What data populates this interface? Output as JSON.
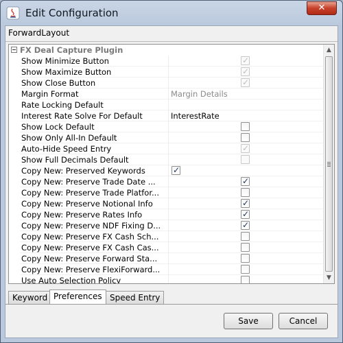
{
  "window": {
    "title": "Edit Configuration",
    "close_glyph": "✕",
    "app_icon": "java-icon"
  },
  "layout_name": "ForwardLayout",
  "group": {
    "title": "FX Deal Capture Plugin",
    "expanded": true
  },
  "rows": [
    {
      "name": "Show Minimize Button",
      "type": "checkbox",
      "checked": true,
      "enabled": false,
      "value": ""
    },
    {
      "name": "Show Maximize Button",
      "type": "checkbox",
      "checked": true,
      "enabled": false,
      "value": ""
    },
    {
      "name": "Show Close Button",
      "type": "checkbox",
      "checked": true,
      "enabled": false,
      "value": ""
    },
    {
      "name": "Margin Format",
      "type": "text",
      "value": "Margin Details",
      "enabled": false
    },
    {
      "name": "Rate Locking Default",
      "type": "text",
      "value": "",
      "enabled": true
    },
    {
      "name": "Interest Rate Solve For Default",
      "type": "text",
      "value": "InterestRate",
      "enabled": true
    },
    {
      "name": "Show Lock Default",
      "type": "checkbox",
      "checked": false,
      "enabled": true,
      "value": ""
    },
    {
      "name": "Show Only All-In Default",
      "type": "checkbox",
      "checked": false,
      "enabled": true,
      "value": ""
    },
    {
      "name": "Auto-Hide Speed Entry",
      "type": "checkbox",
      "checked": true,
      "enabled": false,
      "value": ""
    },
    {
      "name": "Show Full Decimals Default",
      "type": "checkbox",
      "checked": false,
      "enabled": false,
      "value": ""
    },
    {
      "name": "Copy New: Preserved Keywords",
      "type": "checkbox",
      "checked": true,
      "enabled": true,
      "value": "",
      "offset": "left"
    },
    {
      "name": "Copy New: Preserve Trade Date ...",
      "type": "checkbox",
      "checked": true,
      "enabled": true,
      "value": ""
    },
    {
      "name": "Copy New: Preserve Trade Platfor...",
      "type": "checkbox",
      "checked": false,
      "enabled": true,
      "value": ""
    },
    {
      "name": "Copy New: Preserve Notional Info",
      "type": "checkbox",
      "checked": true,
      "enabled": true,
      "value": ""
    },
    {
      "name": "Copy New: Preserve Rates Info",
      "type": "checkbox",
      "checked": true,
      "enabled": true,
      "value": ""
    },
    {
      "name": "Copy New: Preserve NDF Fixing D...",
      "type": "checkbox",
      "checked": true,
      "enabled": true,
      "value": ""
    },
    {
      "name": "Copy New: Preserve FX Cash Sch...",
      "type": "checkbox",
      "checked": false,
      "enabled": true,
      "value": ""
    },
    {
      "name": "Copy New: Preserve FX Cash Cas...",
      "type": "checkbox",
      "checked": false,
      "enabled": true,
      "value": ""
    },
    {
      "name": "Copy New: Preserve Forward Sta...",
      "type": "checkbox",
      "checked": false,
      "enabled": true,
      "value": ""
    },
    {
      "name": "Copy New: Preserve FlexiForward...",
      "type": "checkbox",
      "checked": false,
      "enabled": true,
      "value": ""
    },
    {
      "name": "Use Auto Selection Policy",
      "type": "checkbox",
      "checked": false,
      "enabled": true,
      "value": ""
    }
  ],
  "tabs": [
    {
      "label": "Keyword",
      "active": false
    },
    {
      "label": "Preferences",
      "active": true
    },
    {
      "label": "Speed Entry",
      "active": false
    }
  ],
  "buttons": {
    "save": "Save",
    "cancel": "Cancel"
  },
  "scrollbar": {
    "up_glyph": "▲",
    "down_glyph": "▼"
  }
}
